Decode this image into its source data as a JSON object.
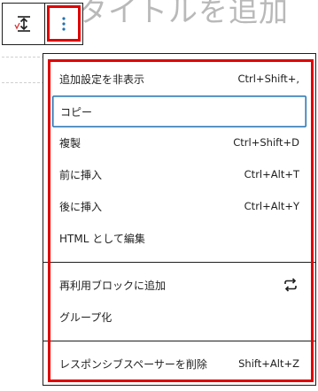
{
  "background_title": "タイトルを追加",
  "toolbar": {
    "spacer_icon": "vertical-spacing-icon",
    "options_icon": "vertical-ellipsis-icon"
  },
  "menu": {
    "section1": [
      {
        "label": "追加設定を非表示",
        "shortcut": "Ctrl+Shift+,"
      },
      {
        "label": "コピー",
        "shortcut": ""
      },
      {
        "label": "複製",
        "shortcut": "Ctrl+Shift+D"
      },
      {
        "label": "前に挿入",
        "shortcut": "Ctrl+Alt+T"
      },
      {
        "label": "後に挿入",
        "shortcut": "Ctrl+Alt+Y"
      },
      {
        "label": "HTML として編集",
        "shortcut": ""
      }
    ],
    "section2": [
      {
        "label": "再利用ブロックに追加",
        "icon": "reusable-block-icon"
      },
      {
        "label": "グループ化"
      }
    ],
    "section3": [
      {
        "label": "レスポンシブスペーサーを削除",
        "shortcut": "Shift+Alt+Z"
      }
    ]
  },
  "colors": {
    "highlight": "#e00000",
    "focus": "#2271b1",
    "options_icon": "#2271b1"
  }
}
